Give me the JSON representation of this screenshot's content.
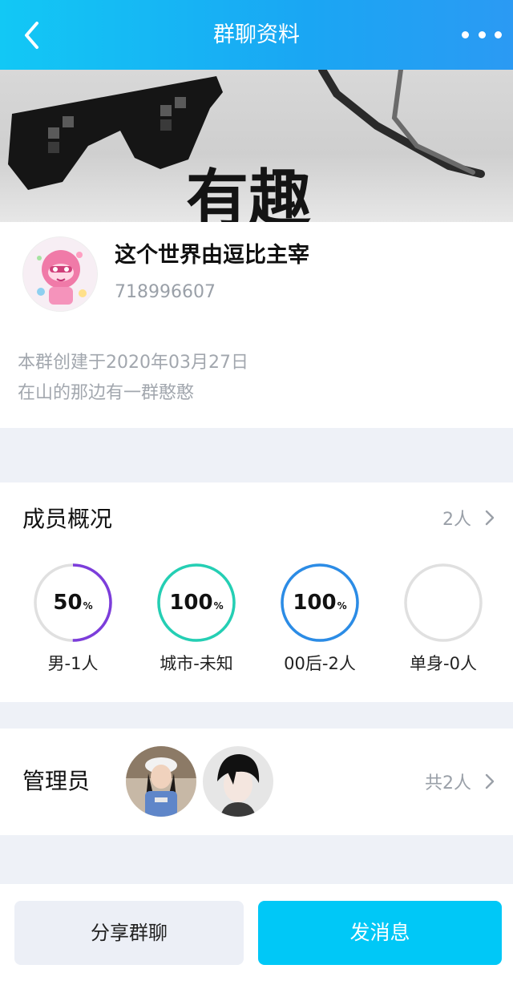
{
  "header": {
    "title": "群聊资料",
    "back_icon": "chevron-left-icon",
    "more_icon": "more-dots-icon"
  },
  "cover": {
    "text": "有趣"
  },
  "group": {
    "name": "这个世界由逗比主宰",
    "id": "718996607",
    "created": "本群创建于2020年03月27日",
    "intro": "在山的那边有一群憨憨"
  },
  "members": {
    "title": "成员概况",
    "count": "2人",
    "stats": [
      {
        "value": "50",
        "unit": "%",
        "label": "男-1人",
        "fraction": 0.5,
        "color": "#7c3ddb"
      },
      {
        "value": "100",
        "unit": "%",
        "label": "城市-未知",
        "fraction": 1.0,
        "color": "#24cfb4"
      },
      {
        "value": "100",
        "unit": "%",
        "label": "00后-2人",
        "fraction": 1.0,
        "color": "#2b8ce6"
      },
      {
        "value": "",
        "unit": "",
        "label": "单身-0人",
        "fraction": 0.0,
        "color": "#e0e0e0"
      }
    ]
  },
  "admins": {
    "title": "管理员",
    "count": "共2人"
  },
  "actions": {
    "share": "分享群聊",
    "send": "发消息"
  },
  "colors": {
    "accent": "#12c8f5",
    "send_button": "#00c8f7",
    "muted_text": "#9aa0a8"
  }
}
